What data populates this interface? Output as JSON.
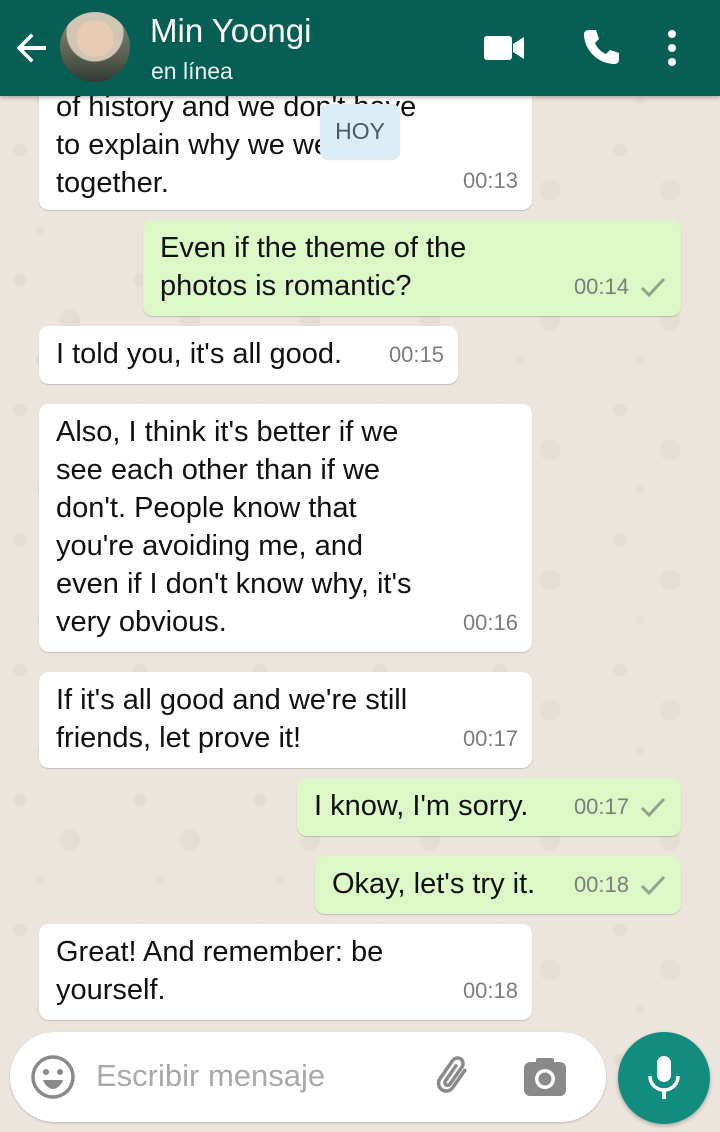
{
  "header": {
    "contact_name": "Min Yoongi",
    "status": "en línea"
  },
  "date_chip": "HOY",
  "messages": [
    {
      "direction": "in",
      "text": "of history and we don't have\nto explain why we were\ntogether.",
      "time": "00:13"
    },
    {
      "direction": "out",
      "text": "Even if the theme of the\nphotos is romantic?",
      "time": "00:14"
    },
    {
      "direction": "in",
      "text": "I told you, it's all good.",
      "time": "00:15"
    },
    {
      "direction": "in",
      "text": "Also, I think it's better if we\nsee each other than if we\ndon't. People know that\nyou're avoiding me, and\neven if I don't know why, it's\nvery obvious.",
      "time": "00:16"
    },
    {
      "direction": "in",
      "text": "If it's all good and we're still\nfriends, let prove it!",
      "time": "00:17"
    },
    {
      "direction": "out",
      "text": "I know, I'm sorry.",
      "time": "00:17"
    },
    {
      "direction": "out",
      "text": "Okay, let's try it.",
      "time": "00:18"
    },
    {
      "direction": "in",
      "text": "Great! And remember: be\nyourself.",
      "time": "00:18"
    }
  ],
  "input": {
    "placeholder": "Escribir mensaje"
  },
  "icons": {
    "back": "arrow-back-icon",
    "video": "video-call-icon",
    "call": "phone-icon",
    "more": "more-vert-icon",
    "emoji": "emoji-icon",
    "attach": "paperclip-icon",
    "camera": "camera-icon",
    "mic": "microphone-icon"
  },
  "colors": {
    "header": "#075e54",
    "incoming_bubble": "#ffffff",
    "outgoing_bubble": "#dcf8c6",
    "mic_button": "#128c7e",
    "wallpaper": "#ece5dd"
  }
}
